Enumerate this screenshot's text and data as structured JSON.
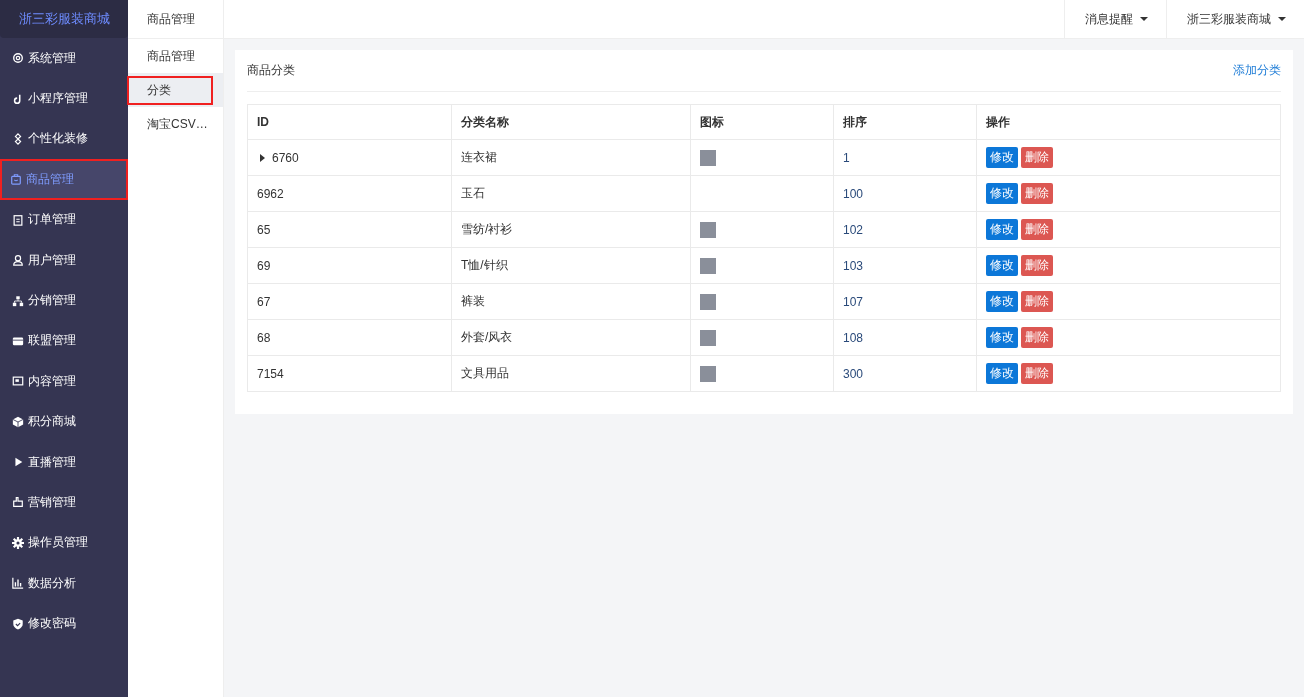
{
  "brand": "浙三彩服装商城",
  "sidebar": {
    "items": [
      {
        "label": "系统管理",
        "selected": false,
        "highlighted": false
      },
      {
        "label": "小程序管理",
        "selected": false,
        "highlighted": false
      },
      {
        "label": "个性化装修",
        "selected": false,
        "highlighted": false
      },
      {
        "label": "商品管理",
        "selected": true,
        "highlighted": true
      },
      {
        "label": "订单管理",
        "selected": false,
        "highlighted": false
      },
      {
        "label": "用户管理",
        "selected": false,
        "highlighted": false
      },
      {
        "label": "分销管理",
        "selected": false,
        "highlighted": false
      },
      {
        "label": "联盟管理",
        "selected": false,
        "highlighted": false
      },
      {
        "label": "内容管理",
        "selected": false,
        "highlighted": false
      },
      {
        "label": "积分商城",
        "selected": false,
        "highlighted": false
      },
      {
        "label": "直播管理",
        "selected": false,
        "highlighted": false
      },
      {
        "label": "营销管理",
        "selected": false,
        "highlighted": false
      },
      {
        "label": "操作员管理",
        "selected": false,
        "highlighted": false
      },
      {
        "label": "数据分析",
        "selected": false,
        "highlighted": false
      },
      {
        "label": "修改密码",
        "selected": false,
        "highlighted": false
      }
    ]
  },
  "submenu": {
    "title": "商品管理",
    "items": [
      {
        "label": "商品管理",
        "selected": false,
        "highlighted": false
      },
      {
        "label": "分类",
        "selected": true,
        "highlighted": true
      },
      {
        "label": "淘宝CSV…",
        "selected": false,
        "highlighted": false
      }
    ]
  },
  "topbar": {
    "menus": [
      "消息提醒",
      "浙三彩服装商城"
    ]
  },
  "card": {
    "title": "商品分类",
    "action": "添加分类",
    "table": {
      "columns": [
        "ID",
        "分类名称",
        "图标",
        "排序",
        "操作"
      ],
      "rows": [
        {
          "id": "6760",
          "expandable": true,
          "name": "连衣裙",
          "thumbnail": true,
          "sort": "1",
          "edit": "修改",
          "delete": "删除"
        },
        {
          "id": "6962",
          "expandable": false,
          "name": "玉石",
          "thumbnail": false,
          "sort": "100",
          "edit": "修改",
          "delete": "删除"
        },
        {
          "id": "65",
          "expandable": false,
          "name": "雪纺/衬衫",
          "thumbnail": true,
          "sort": "102",
          "edit": "修改",
          "delete": "删除"
        },
        {
          "id": "69",
          "expandable": false,
          "name": "T恤/针织",
          "thumbnail": true,
          "sort": "103",
          "edit": "修改",
          "delete": "删除"
        },
        {
          "id": "67",
          "expandable": false,
          "name": "裤装",
          "thumbnail": true,
          "sort": "107",
          "edit": "修改",
          "delete": "删除"
        },
        {
          "id": "68",
          "expandable": false,
          "name": "外套/风衣",
          "thumbnail": true,
          "sort": "108",
          "edit": "修改",
          "delete": "删除"
        },
        {
          "id": "7154",
          "expandable": false,
          "name": "文具用品",
          "thumbnail": true,
          "sort": "300",
          "edit": "修改",
          "delete": "删除"
        }
      ]
    }
  }
}
